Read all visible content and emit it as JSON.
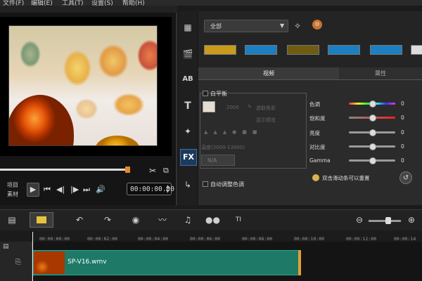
{
  "menu": {
    "file": "文件(F)",
    "edit": "编辑(E)",
    "tools": "工具(T)",
    "settings": "设置(S)",
    "help": "帮助(H)"
  },
  "preview": {
    "project_label": "项目",
    "clip_label": "素材",
    "timecode": "00:00:00.00",
    "progress": 0.75
  },
  "library": {
    "dropdown_value": "全部"
  },
  "options": {
    "tab_video": "视频",
    "tab_attributes": "属性",
    "white_balance_label": "白平衡",
    "wb_value": "2000",
    "pick_color_label": "选取色彩",
    "show_preview_label": "显示预览",
    "temperature_label": "温度(2000-13000)",
    "temperature_value": "N/A",
    "auto_tone_label": "自动调整色调",
    "hint": "双击滑动条可以重置",
    "sliders": [
      {
        "label": "色调",
        "value": "0",
        "position": 0.5
      },
      {
        "label": "饱和度",
        "value": "0",
        "position": 0.5
      },
      {
        "label": "亮度",
        "value": "0",
        "position": 0.5
      },
      {
        "label": "对比度",
        "value": "0",
        "position": 0.5
      },
      {
        "label": "Gamma",
        "value": "0",
        "position": 0.5
      }
    ]
  },
  "timeline": {
    "ticks": [
      "00:00:00:00",
      "00:00:02:00",
      "00:00:04:00",
      "00:00:06:00",
      "00:00:08:00",
      "00:00:10:00",
      "00:00:12:00",
      "00:00:14"
    ],
    "clip_name": "SP-V16.wmv",
    "zoom_position": 0.6
  },
  "colors": {
    "accent": "#3c6fa7",
    "clip": "#1e7a67",
    "handle": "#e28a2a"
  }
}
